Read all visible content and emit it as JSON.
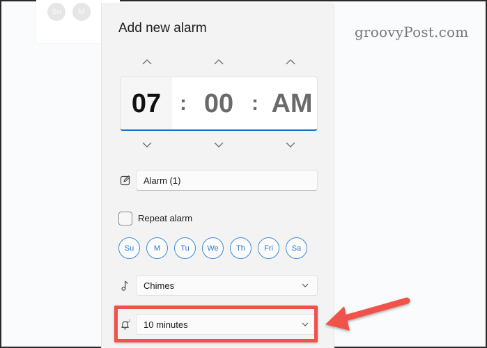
{
  "background": {
    "days": [
      "Su",
      "M"
    ]
  },
  "watermark": "groovyPost.com",
  "panel": {
    "title": "Add new alarm",
    "time": {
      "hour": "07",
      "minute": "00",
      "period": "AM",
      "separator": ":"
    },
    "alarm_name": {
      "value": "Alarm (1)",
      "icon": "edit-icon"
    },
    "repeat": {
      "label": "Repeat alarm",
      "checked": false
    },
    "days": [
      "Su",
      "M",
      "Tu",
      "We",
      "Th",
      "Fri",
      "Sa"
    ],
    "sound": {
      "value": "Chimes",
      "icon": "music-note-icon"
    },
    "snooze": {
      "value": "10 minutes",
      "icon": "snooze-bell-icon"
    }
  },
  "annotation": {
    "highlight_color": "#f0524a",
    "accent_color": "#1d6fc6"
  }
}
